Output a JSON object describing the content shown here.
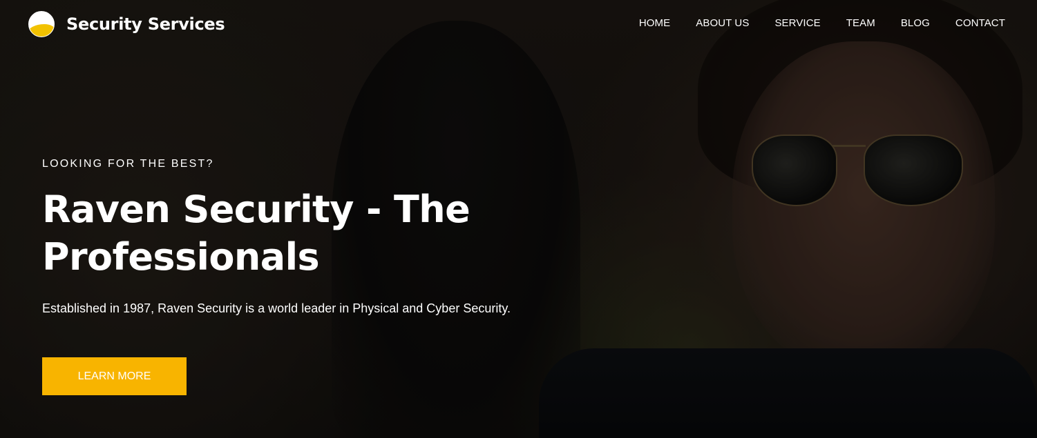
{
  "brand": {
    "name": "Security Services",
    "logo_icon": "half-sun-logo-icon",
    "accent_color": "#f8b400"
  },
  "nav": {
    "items": [
      {
        "label": "HOME"
      },
      {
        "label": "ABOUT US"
      },
      {
        "label": "SERVICE"
      },
      {
        "label": "TEAM"
      },
      {
        "label": "BLOG"
      },
      {
        "label": "CONTACT"
      }
    ]
  },
  "hero": {
    "eyebrow": "LOOKING FOR THE BEST?",
    "headline": "Raven Security - The Professionals",
    "description": "Established in 1987, Raven Security is a world leader in Physical and Cyber Security.",
    "cta_label": "LEARN MORE"
  }
}
